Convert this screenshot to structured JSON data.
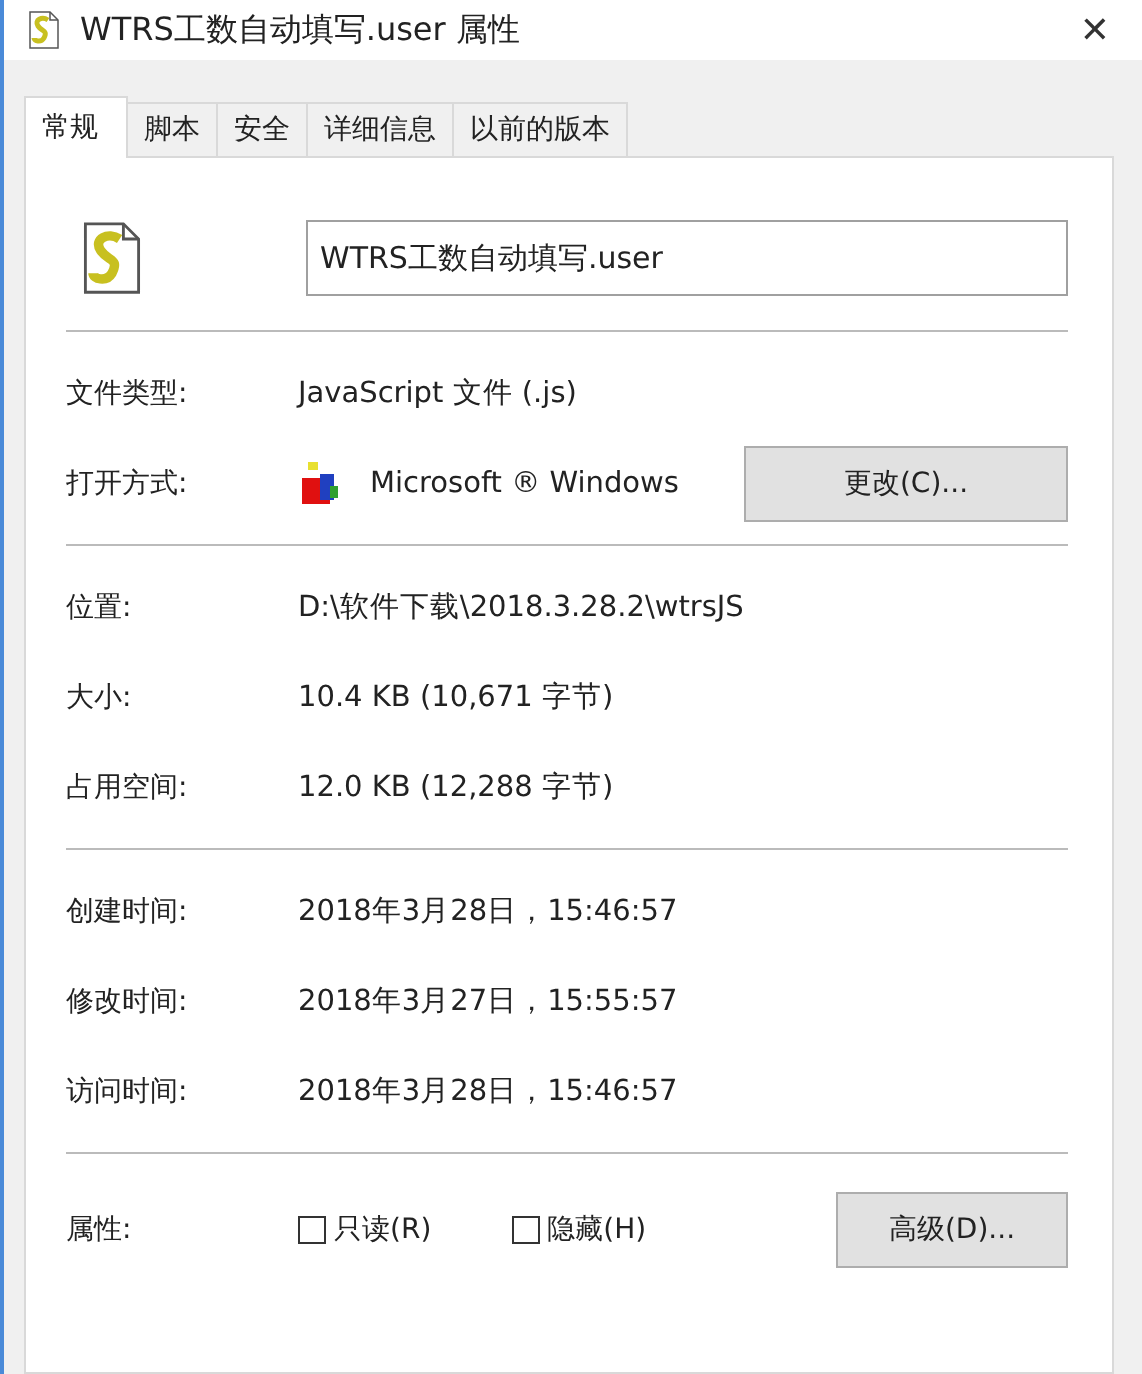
{
  "window": {
    "title": "WTRS工数自动填写.user 属性",
    "close": "✕"
  },
  "tabs": [
    {
      "label": "常规",
      "selected": true
    },
    {
      "label": "脚本",
      "selected": false
    },
    {
      "label": "安全",
      "selected": false
    },
    {
      "label": "详细信息",
      "selected": false
    },
    {
      "label": "以前的版本",
      "selected": false
    }
  ],
  "file_name": "WTRS工数自动填写.user",
  "sections": [
    {
      "rows": [
        {
          "label": "文件类型:",
          "value": "JavaScript 文件 (.js)"
        },
        {
          "label": "打开方式:",
          "value": "Microsoft ® Windows",
          "button": "更改(C)..."
        }
      ]
    },
    {
      "rows": [
        {
          "label": "位置:",
          "value": "D:\\软件下载\\2018.3.28.2\\wtrsJS"
        },
        {
          "label": "大小:",
          "value": "10.4 KB (10,671 字节)"
        },
        {
          "label": "占用空间:",
          "value": "12.0 KB (12,288 字节)"
        }
      ]
    },
    {
      "rows": [
        {
          "label": "创建时间:",
          "value": "2018年3月28日，15:46:57"
        },
        {
          "label": "修改时间:",
          "value": "2018年3月27日，15:55:57"
        },
        {
          "label": "访问时间:",
          "value": "2018年3月28日，15:46:57"
        }
      ]
    }
  ],
  "attributes": {
    "label": "属性:",
    "options": [
      {
        "label": "只读(R)",
        "checked": false
      },
      {
        "label": "隐藏(H)",
        "checked": false
      }
    ],
    "button": "高级(D)..."
  }
}
